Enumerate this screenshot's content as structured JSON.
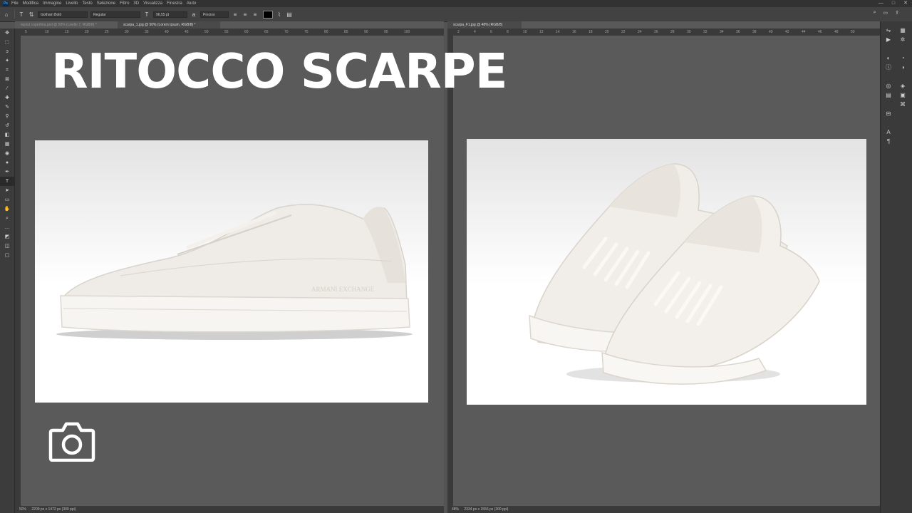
{
  "app": {
    "logo": "Ps",
    "menu": [
      "File",
      "Modifica",
      "Immagine",
      "Livello",
      "Testo",
      "Selezione",
      "Filtro",
      "3D",
      "Visualizza",
      "Finestra",
      "Aiuto"
    ],
    "window_controls": [
      "—",
      "□",
      "✕"
    ]
  },
  "options_bar": {
    "home_icon": "home-icon",
    "tool_icon": "type-tool-icon",
    "font_family": "Gotham Bold",
    "font_style": "Regular",
    "font_size": "96,55 pt",
    "antialias": "Preciso",
    "color_swatch": "#000000"
  },
  "documents": [
    {
      "tabs": [
        {
          "label": "layout copertina.psd @ 50% (Livello 7, RGB/8) *",
          "active": false
        },
        {
          "label": "scarpa_1.jpg @ 50% (Lorem Ipsum, RGB/8) *",
          "active": true
        }
      ],
      "ruler_ticks": [
        "5",
        "10",
        "15",
        "20",
        "25",
        "30",
        "35",
        "40",
        "45",
        "50",
        "55",
        "60",
        "65",
        "70",
        "75",
        "80",
        "85",
        "90",
        "95",
        "100"
      ],
      "zoom": "50%",
      "status": "2209 px x 1472 px (300 ppi)"
    },
    {
      "tabs": [
        {
          "label": "scarpa_F1.jpg @ 48% (RGB/8)",
          "active": true
        }
      ],
      "ruler_ticks": [
        "2",
        "4",
        "6",
        "8",
        "10",
        "12",
        "14",
        "16",
        "18",
        "20",
        "22",
        "24",
        "26",
        "28",
        "30",
        "32",
        "34",
        "36",
        "38",
        "40",
        "42",
        "44",
        "46",
        "48",
        "50"
      ],
      "zoom": "48%",
      "status": "2334 px x 1556 px (300 ppi)"
    }
  ],
  "overlay": {
    "title": "RITOCCO SCARPE",
    "title_color": "#ffffff",
    "icon": "camera-icon"
  },
  "photos": [
    {
      "subject": "single-white-sneaker-side-view",
      "brand_text": "ARMANI EXCHANGE"
    },
    {
      "subject": "pair-of-white-sneakers"
    }
  ]
}
